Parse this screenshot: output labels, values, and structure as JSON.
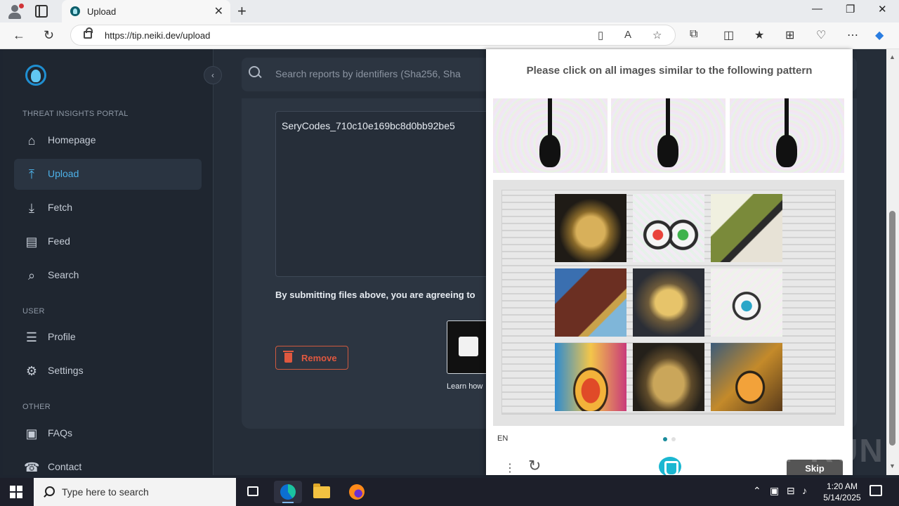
{
  "browser": {
    "tab_title": "Upload",
    "new_tab": "+",
    "url": "https://tip.neiki.dev/upload",
    "win_minimize": "—",
    "win_restore": "❐",
    "win_close": "✕"
  },
  "sidebar": {
    "collapse_glyph": "‹",
    "sections": {
      "portal": "THREAT INSIGHTS PORTAL",
      "user": "USER",
      "other": "OTHER"
    },
    "items": [
      {
        "label": "Homepage",
        "icon": "home-icon",
        "glyph": "⌂"
      },
      {
        "label": "Upload",
        "icon": "upload-icon",
        "glyph": "⤒"
      },
      {
        "label": "Fetch",
        "icon": "download-icon",
        "glyph": "⤓"
      },
      {
        "label": "Feed",
        "icon": "feed-icon",
        "glyph": "▤"
      },
      {
        "label": "Search",
        "icon": "search-icon",
        "glyph": "⌕"
      },
      {
        "label": "Profile",
        "icon": "profile-icon",
        "glyph": "☰"
      },
      {
        "label": "Settings",
        "icon": "gear-icon",
        "glyph": "⚙"
      },
      {
        "label": "FAQs",
        "icon": "faq-icon",
        "glyph": "▣"
      },
      {
        "label": "Contact",
        "icon": "contact-icon",
        "glyph": "☎"
      }
    ]
  },
  "main": {
    "search_placeholder": "Search reports by identifiers (Sha256, Sha",
    "file_name": "SeryCodes_710c10e169bc8d0bb92be5",
    "agree_text": "By submitting files above, you are agreeing to",
    "remove_label": "Remove",
    "learn_text": "Learn how"
  },
  "captcha": {
    "prompt": "Please click on all images similar to the following pattern",
    "language": "EN",
    "skip_label": "Skip",
    "menu_glyph": "⋮",
    "refresh_glyph": "↻",
    "accent_color": "#1a8c9c"
  },
  "watermark": "ANY RUN",
  "taskbar": {
    "search_placeholder": "Type here to search",
    "time": "1:20 AM",
    "date": "5/14/2025"
  }
}
